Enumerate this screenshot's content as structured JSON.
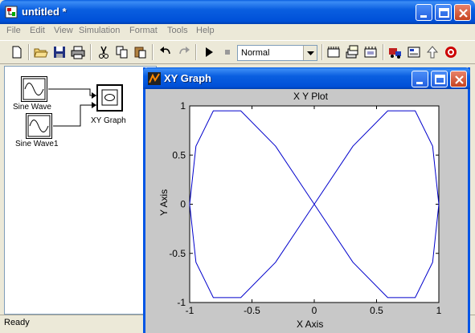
{
  "window": {
    "title": "untitled *"
  },
  "menu": [
    "File",
    "Edit",
    "View",
    "Simulation",
    "Format",
    "Tools",
    "Help"
  ],
  "toolbar": {
    "sim_mode": "Normal"
  },
  "model": {
    "blocks": [
      {
        "label": "Sine Wave"
      },
      {
        "label": "Sine Wave1"
      },
      {
        "label": "XY Graph"
      }
    ]
  },
  "status": "Ready",
  "xy_window": {
    "title": "XY Graph"
  },
  "chart_data": {
    "type": "line",
    "title": "X Y Plot",
    "xlabel": "X Axis",
    "ylabel": "Y Axis",
    "xlim": [
      -1,
      1
    ],
    "ylim": [
      -1,
      1
    ],
    "xticks": [
      "-1",
      "-0.5",
      "0",
      "0.5",
      "1"
    ],
    "yticks": [
      "1",
      "0.5",
      "0",
      "-0.5",
      "-1"
    ],
    "series": [
      {
        "color": "#0000cc",
        "x": [
          0,
          0.31,
          0.59,
          0.81,
          0.95,
          1.0,
          0.95,
          0.81,
          0.59,
          0.31,
          0,
          -0.31,
          -0.59,
          -0.81,
          -0.95,
          -1.0,
          -0.95,
          -0.81,
          -0.59,
          -0.31,
          0
        ],
        "y": [
          0,
          0.59,
          0.95,
          0.95,
          0.59,
          0,
          -0.59,
          -0.95,
          -0.95,
          -0.59,
          0,
          0.59,
          0.95,
          0.95,
          0.59,
          0,
          -0.59,
          -0.95,
          -0.95,
          -0.59,
          0
        ]
      }
    ]
  }
}
